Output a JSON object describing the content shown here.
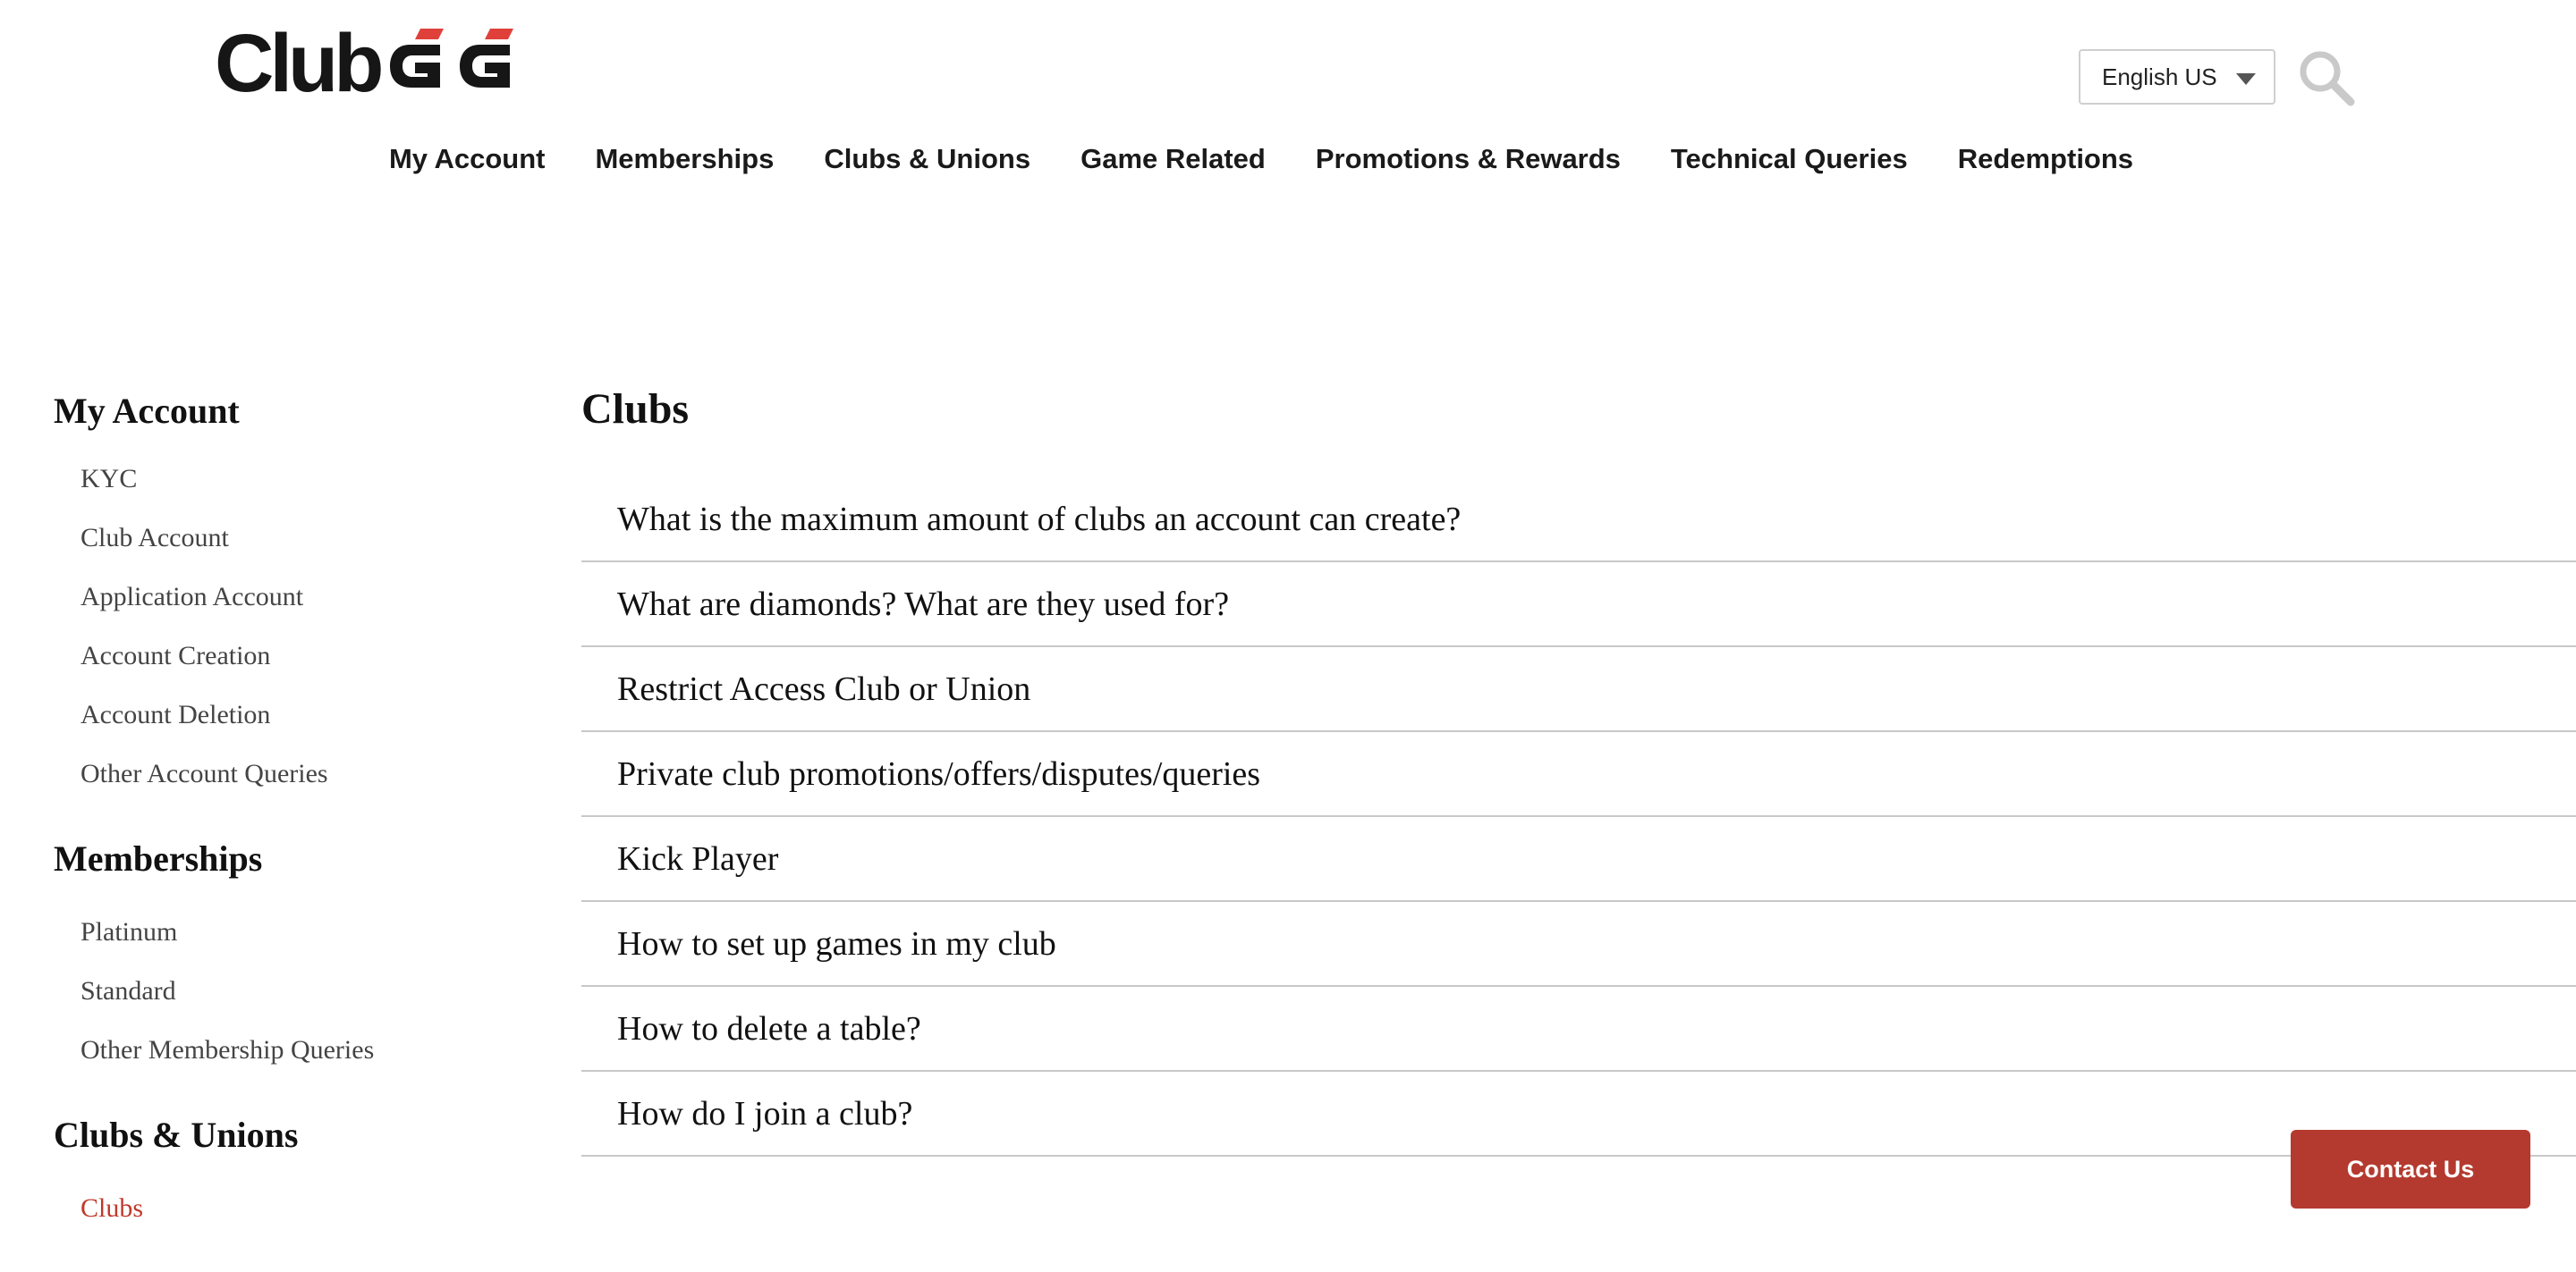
{
  "brand": {
    "logo_club": "Club",
    "logo_gg": "GG",
    "accent_color": "#b43a2f",
    "logo_red": "#e0403a"
  },
  "header": {
    "language": {
      "selected": "English US"
    },
    "search_icon": "search-icon",
    "nav": [
      {
        "label": "My Account"
      },
      {
        "label": "Memberships"
      },
      {
        "label": "Clubs & Unions"
      },
      {
        "label": "Game Related"
      },
      {
        "label": "Promotions & Rewards"
      },
      {
        "label": "Technical Queries"
      },
      {
        "label": "Redemptions"
      }
    ]
  },
  "sidebar": {
    "sections": [
      {
        "heading": "My Account",
        "items": [
          {
            "label": "KYC"
          },
          {
            "label": "Club Account"
          },
          {
            "label": "Application Account"
          },
          {
            "label": "Account Creation"
          },
          {
            "label": "Account Deletion"
          },
          {
            "label": "Other Account Queries"
          }
        ]
      },
      {
        "heading": "Memberships",
        "items": [
          {
            "label": "Platinum"
          },
          {
            "label": "Standard"
          },
          {
            "label": "Other Membership Queries"
          }
        ]
      },
      {
        "heading": "Clubs & Unions",
        "items": [
          {
            "label": "Clubs",
            "active": true
          }
        ]
      }
    ]
  },
  "main": {
    "title": "Clubs",
    "faqs": [
      {
        "question": "What is the maximum amount of clubs an account can create?"
      },
      {
        "question": "What are diamonds? What are they used for?"
      },
      {
        "question": "Restrict Access Club or Union"
      },
      {
        "question": "Private club promotions/offers/disputes/queries"
      },
      {
        "question": "Kick Player"
      },
      {
        "question": "How to set up games in my club"
      },
      {
        "question": "How to delete a table?"
      },
      {
        "question": "How do I join a club?"
      }
    ]
  },
  "contact": {
    "label": "Contact Us"
  }
}
